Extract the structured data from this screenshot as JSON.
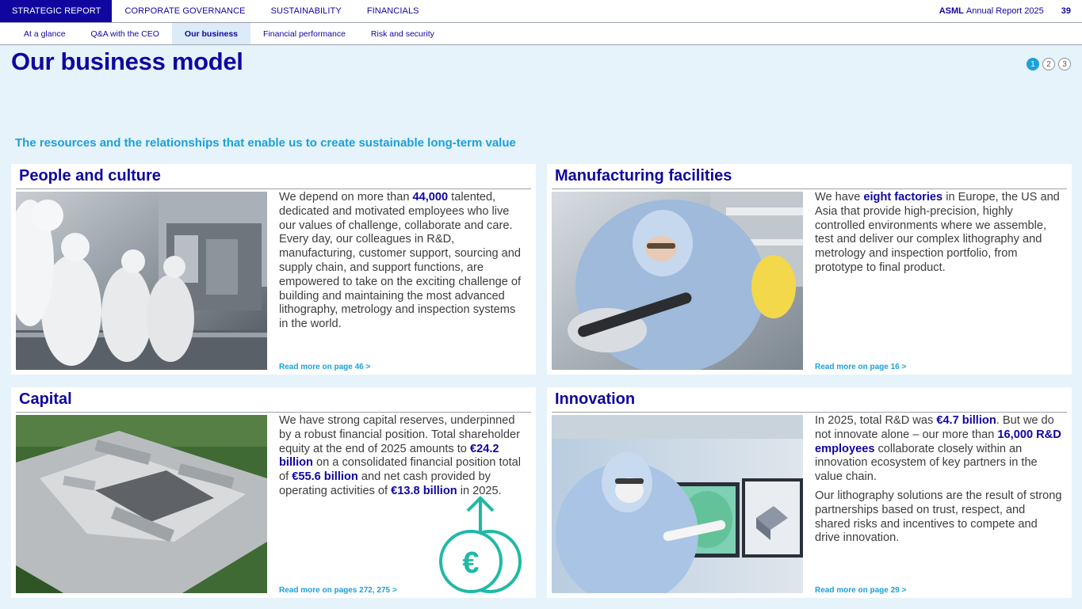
{
  "topnav": {
    "tabs": [
      "STRATEGIC REPORT",
      "CORPORATE GOVERNANCE",
      "SUSTAINABILITY",
      "FINANCIALS"
    ],
    "brand": "ASML",
    "report": "Annual Report 2025",
    "page": "39"
  },
  "subnav": {
    "items": [
      "At a glance",
      "Q&A with the CEO",
      "Our business",
      "Financial performance",
      "Risk and security"
    ]
  },
  "page": {
    "title": "Our business model",
    "pager": [
      "1",
      "2",
      "3"
    ],
    "tagline": "The resources and the relationships that enable us to create sustainable long-term value"
  },
  "cards": [
    {
      "title": "People and culture",
      "body_parts": [
        "We depend on more than ",
        "44,000",
        " talented, dedicated and motivated employees who live our values of challenge, collaborate and care. Every day, our colleagues in R&D, manufacturing, customer support, sourcing and supply chain, and support functions, are empowered to take on the exciting challenge of building and maintaining the most advanced lithography, metrology and inspection systems in the world."
      ],
      "link": "Read more on page 46 >"
    },
    {
      "title": "Manufacturing facilities",
      "body_parts": [
        "We have ",
        "eight factories",
        " in Europe, the US and Asia that provide high-precision, highly controlled environments where we assemble, test and deliver our complex lithography and metrology and inspection portfolio, from prototype to final product."
      ],
      "link": "Read more on page 16 >"
    },
    {
      "title": "Capital",
      "body_parts": [
        "We have strong capital reserves, underpinned by a robust financial position. Total shareholder equity at the end of 2025 amounts to ",
        "€24.2 billion",
        " on a consolidated financial position total of ",
        "€55.6 billion",
        " and net cash provided by operating activities of ",
        "€13.8 billion",
        " in 2025."
      ],
      "link": "Read more on pages 272, 275 >"
    },
    {
      "title": "Innovation",
      "body_parts": [
        "In 2025, total R&D was ",
        "€4.7 billion",
        ". But we do not innovate alone – our more than ",
        "16,000 R&D employees",
        " collaborate closely within an innovation ecosystem of key partners in the value chain."
      ],
      "body2": "Our lithography solutions are the result of strong partnerships based on trust, respect, and shared risks and incentives to compete and drive innovation.",
      "link": "Read more on page 29 >"
    }
  ],
  "icons": {
    "capital": "euro-coin-arrow-icon"
  },
  "colors": {
    "brand": "#10069f",
    "accent": "#1ba0d9",
    "teal": "#1fb9a6",
    "background": "#e6f3fb"
  }
}
